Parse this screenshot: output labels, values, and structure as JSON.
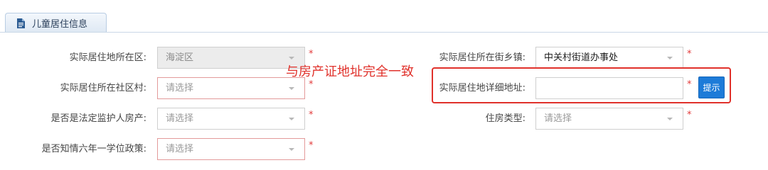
{
  "tab": {
    "label": "儿童居住信息",
    "icon": "document-icon"
  },
  "fields": {
    "district": {
      "label": "实际居住地所在区:",
      "value": "海淀区",
      "disabled": true
    },
    "street": {
      "label": "实际居住所在街乡镇:",
      "value": "中关村街道办事处"
    },
    "community": {
      "label": "实际居住所在社区村:",
      "placeholder": "请选择"
    },
    "detail_address": {
      "label": "实际居住地详细地址:",
      "value": "",
      "placeholder": ""
    },
    "guardian_property": {
      "label": "是否是法定监护人房产:",
      "placeholder": "请选择"
    },
    "housing_type": {
      "label": "住房类型:",
      "placeholder": "请选择"
    },
    "policy_aware": {
      "label": "是否知情六年一学位政策:",
      "placeholder": "请选择"
    }
  },
  "required_mark": "*",
  "hint_button_label": "提示",
  "annotation": {
    "text": "与房产证地址完全一致",
    "color": "#e0312b"
  },
  "colors": {
    "accent": "#1d7bd8",
    "required": "#e23b3b",
    "disabled_bg": "#ececec"
  }
}
